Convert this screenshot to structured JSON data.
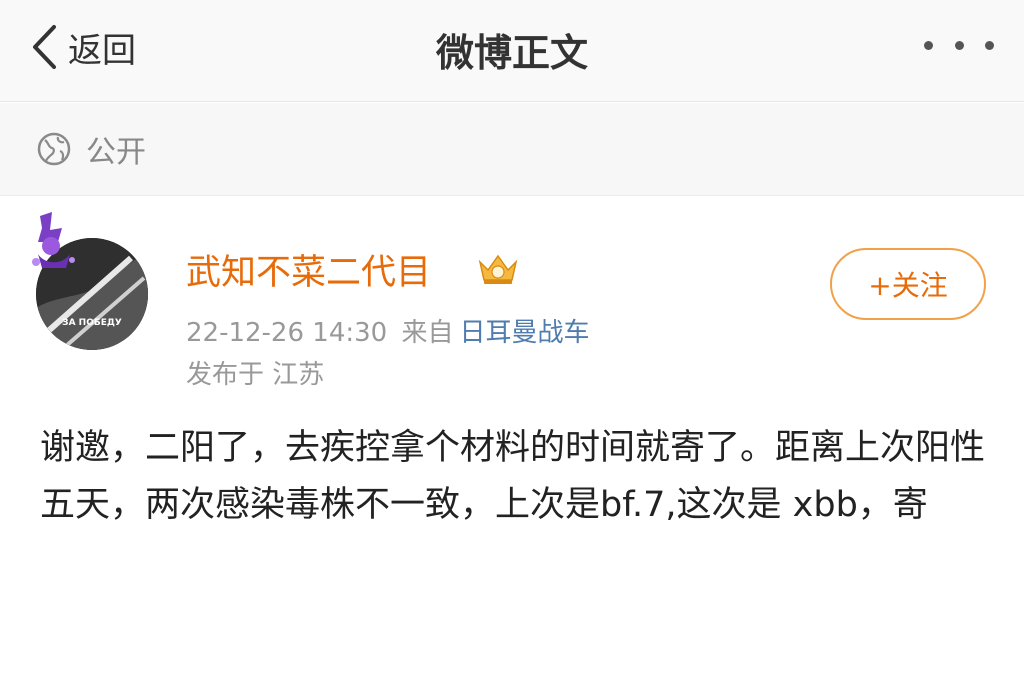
{
  "navbar": {
    "back_label": "返回",
    "title": "微博正文",
    "more_icon": "more-dots-icon"
  },
  "visibility": {
    "icon": "globe-icon",
    "label": "公开"
  },
  "post": {
    "author": {
      "name": "武知不菜二代目",
      "avatar_text": "ЗА ПОБЕДУ",
      "badge_icon": "vip-crown-icon"
    },
    "timestamp": "22-12-26 14:30",
    "source_prefix": "来自",
    "source": "日耳曼战车",
    "location": "发布于 江苏",
    "follow_label": "+关注",
    "text": "谢邀，二阳了，去疾控拿个材料的时间就寄了。距离上次阳性五天，两次感染毒株不一致，上次是bf.7,这次是 xbb，寄"
  },
  "colors": {
    "username": "#e86b0a",
    "source_link": "#507daf",
    "meta_gray": "#999999",
    "follow_border": "#f0a14a"
  }
}
